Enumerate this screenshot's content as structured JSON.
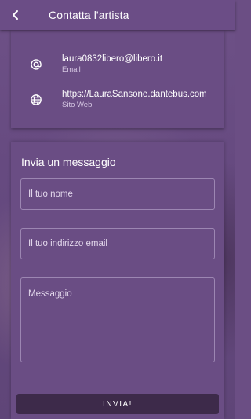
{
  "header": {
    "title": "Contatta l'artista",
    "back_icon": "chevron-left-icon"
  },
  "contact": {
    "email": {
      "value": "laura0832libero@libero.it",
      "label": "Email",
      "icon": "at-sign-icon"
    },
    "website": {
      "value": "https://LauraSansone.dantebus.com",
      "label": "Sito Web",
      "icon": "globe-icon"
    }
  },
  "message_form": {
    "title": "Invia un messaggio",
    "name_placeholder": "Il tuo nome",
    "email_placeholder": "Il tuo indirizzo email",
    "message_placeholder": "Messaggio",
    "send_label": "INVIA!"
  },
  "colors": {
    "appbar": "#6b4d86",
    "card": "#6a4d84",
    "button": "#3d2a4a",
    "field_border": "#9c86b2"
  }
}
